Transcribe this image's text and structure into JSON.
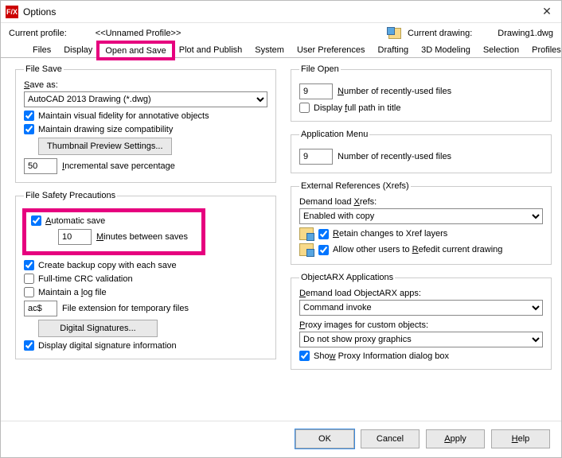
{
  "window": {
    "title": "Options",
    "app_icon_text": "F/X"
  },
  "profile": {
    "label": "Current profile:",
    "name": "<<Unnamed Profile>>",
    "drawing_label": "Current drawing:",
    "drawing_name": "Drawing1.dwg"
  },
  "tabs": {
    "items": [
      "Files",
      "Display",
      "Open and Save",
      "Plot and Publish",
      "System",
      "User Preferences",
      "Drafting",
      "3D Modeling",
      "Selection",
      "Profiles"
    ],
    "active": "Open and Save"
  },
  "file_save": {
    "legend": "File Save",
    "save_as_label": "Save as:",
    "save_as_value": "AutoCAD 2013 Drawing (*.dwg)",
    "maintain_visual": "Maintain visual fidelity for annotative objects",
    "maintain_size": "Maintain drawing size compatibility",
    "thumbnail_btn": "Thumbnail Preview Settings...",
    "incremental_value": "50",
    "incremental_label": "Incremental save percentage"
  },
  "safety": {
    "legend": "File Safety Precautions",
    "auto_save": "Automatic save",
    "minutes_value": "10",
    "minutes_label": "Minutes between saves",
    "backup": "Create backup copy with each save",
    "crc": "Full-time CRC validation",
    "logfile": "Maintain a log file",
    "ext_value": "ac$",
    "ext_label": "File extension for temporary files",
    "sig_btn": "Digital Signatures...",
    "display_sig": "Display digital signature information"
  },
  "file_open": {
    "legend": "File Open",
    "recent_value": "9",
    "recent_label": "Number of recently-used files",
    "fullpath": "Display full path in title"
  },
  "app_menu": {
    "legend": "Application Menu",
    "recent_value": "9",
    "recent_label": "Number of recently-used files"
  },
  "xrefs": {
    "legend": "External References (Xrefs)",
    "demand_label": "Demand load Xrefs:",
    "demand_value": "Enabled with copy",
    "retain": "Retain changes to Xref layers",
    "allow_edit": "Allow other users to Refedit current drawing"
  },
  "arx": {
    "legend": "ObjectARX Applications",
    "demand_label": "Demand load ObjectARX apps:",
    "demand_value": "Command invoke",
    "proxy_label": "Proxy images for custom objects:",
    "proxy_value": "Do not show proxy graphics",
    "show_dialog": "Show Proxy Information dialog box"
  },
  "footer": {
    "ok": "OK",
    "cancel": "Cancel",
    "apply": "Apply",
    "help": "Help"
  }
}
